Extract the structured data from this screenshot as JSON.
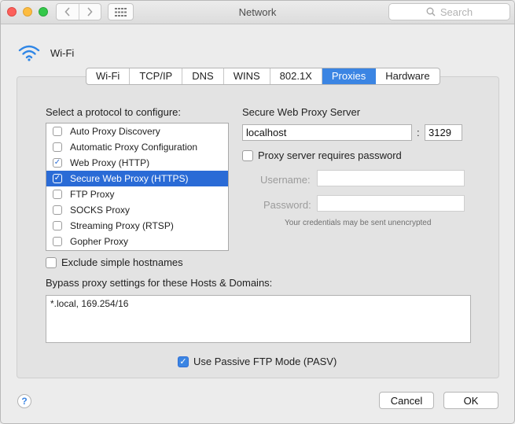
{
  "window": {
    "title": "Network",
    "search_placeholder": "Search"
  },
  "service": {
    "name": "Wi-Fi"
  },
  "tabs": [
    {
      "label": "Wi-Fi",
      "active": false
    },
    {
      "label": "TCP/IP",
      "active": false
    },
    {
      "label": "DNS",
      "active": false
    },
    {
      "label": "WINS",
      "active": false
    },
    {
      "label": "802.1X",
      "active": false
    },
    {
      "label": "Proxies",
      "active": true
    },
    {
      "label": "Hardware",
      "active": false
    }
  ],
  "protocols": {
    "heading": "Select a protocol to configure:",
    "items": [
      {
        "label": "Auto Proxy Discovery",
        "checked": false,
        "selected": false
      },
      {
        "label": "Automatic Proxy Configuration",
        "checked": false,
        "selected": false
      },
      {
        "label": "Web Proxy (HTTP)",
        "checked": true,
        "selected": false
      },
      {
        "label": "Secure Web Proxy (HTTPS)",
        "checked": true,
        "selected": true
      },
      {
        "label": "FTP Proxy",
        "checked": false,
        "selected": false
      },
      {
        "label": "SOCKS Proxy",
        "checked": false,
        "selected": false
      },
      {
        "label": "Streaming Proxy (RTSP)",
        "checked": false,
        "selected": false
      },
      {
        "label": "Gopher Proxy",
        "checked": false,
        "selected": false
      }
    ]
  },
  "server": {
    "heading": "Secure Web Proxy Server",
    "host": "localhost",
    "separator": ":",
    "port": "3129",
    "requires_password_label": "Proxy server requires password",
    "requires_password": false,
    "username_label": "Username:",
    "username": "",
    "password_label": "Password:",
    "password": "",
    "note": "Your credentials may be sent unencrypted"
  },
  "exclude_simple": {
    "label": "Exclude simple hostnames",
    "checked": false
  },
  "bypass": {
    "label": "Bypass proxy settings for these Hosts & Domains:",
    "value": "*.local, 169.254/16"
  },
  "passive_ftp": {
    "label": "Use Passive FTP Mode (PASV)",
    "checked": true
  },
  "footer": {
    "help_label": "?",
    "cancel_label": "Cancel",
    "ok_label": "OK"
  },
  "colors": {
    "accent": "#3b85e3",
    "selection": "#2a6bd6",
    "close": "#fc605b",
    "minimize": "#fdbc40",
    "zoom": "#34c84a"
  }
}
